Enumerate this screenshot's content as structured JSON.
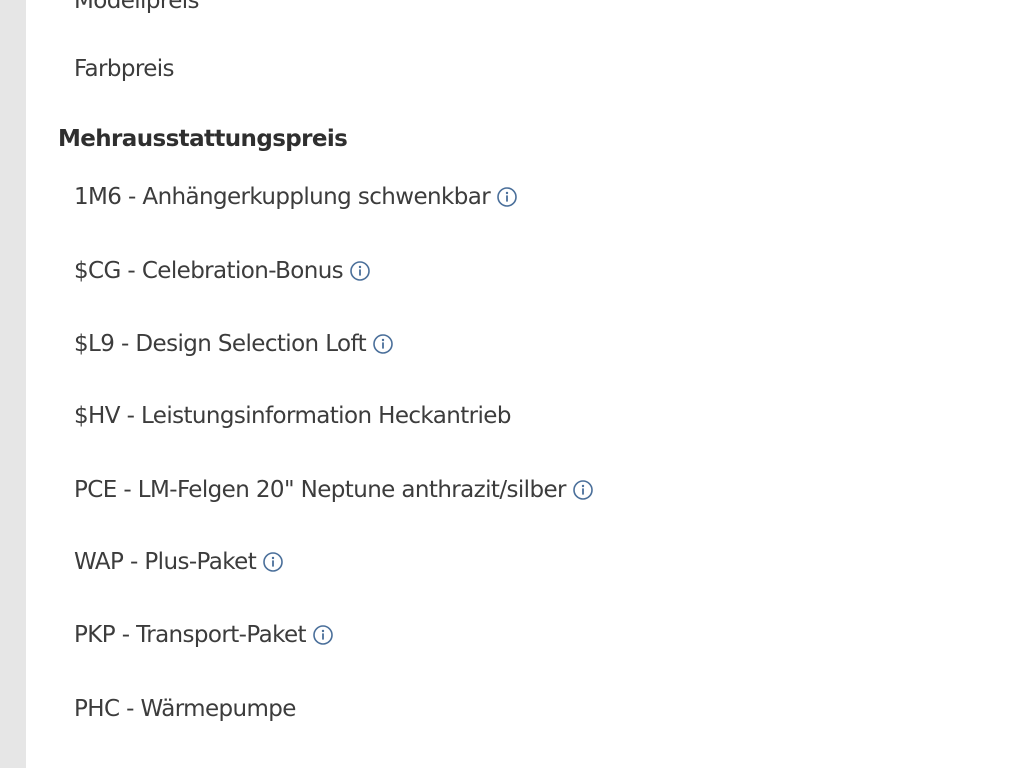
{
  "price_list": {
    "cut_top_label": "Modellpreis",
    "color_price_label": "Farbpreis",
    "section_heading": "Mehrausstattungspreis",
    "items": [
      {
        "label": "1M6 - Anhängerkupplung schwenkbar",
        "info": true
      },
      {
        "label": "$CG - Celebration-Bonus",
        "info": true
      },
      {
        "label": "$L9 - Design Selection Loft",
        "info": true
      },
      {
        "label": "$HV - Leistungsinformation Heckantrieb",
        "info": false
      },
      {
        "label": "PCE - LM-Felgen 20\" Neptune anthrazit/silber",
        "info": true
      },
      {
        "label": "WAP - Plus-Paket",
        "info": true
      },
      {
        "label": "PKP - Transport-Paket",
        "info": true
      },
      {
        "label": "PHC - Wärmepumpe",
        "info": false
      }
    ]
  },
  "colors": {
    "gutter": "#e6e6e6",
    "text": "#3c3c3c",
    "heading": "#2f2f2f",
    "icon": "#4a6f9a"
  },
  "icons": {
    "info": "info-circle-icon"
  }
}
